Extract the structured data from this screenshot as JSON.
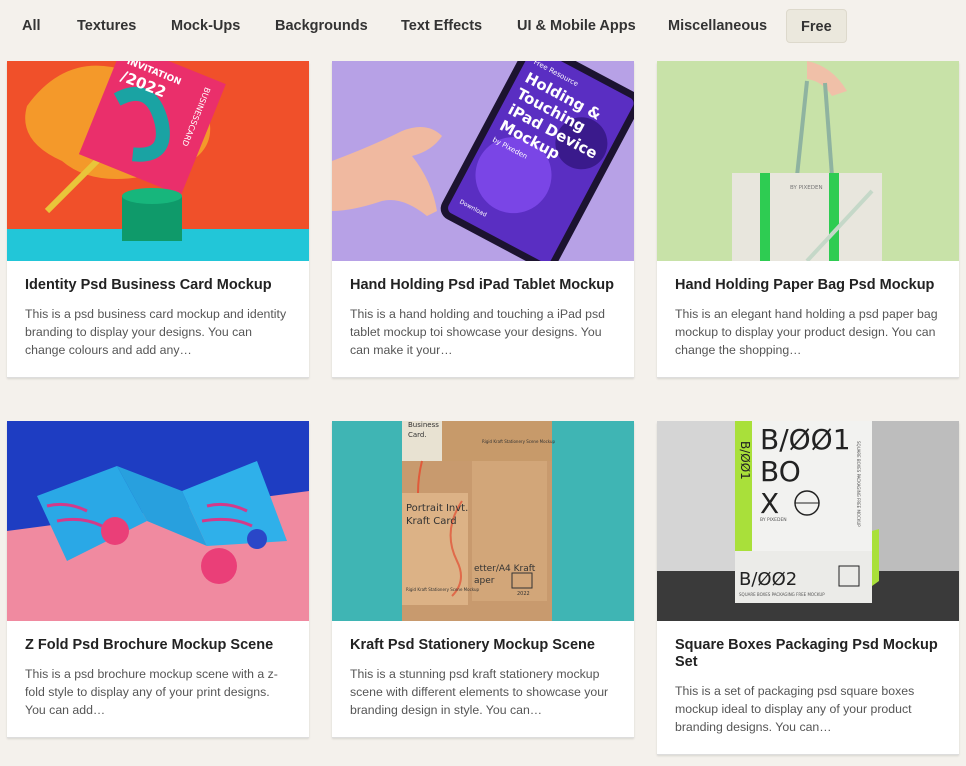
{
  "filters": [
    {
      "label": "All",
      "active": false
    },
    {
      "label": "Textures",
      "active": false
    },
    {
      "label": "Mock-Ups",
      "active": false
    },
    {
      "label": "Backgrounds",
      "active": false
    },
    {
      "label": "Text Effects",
      "active": false
    },
    {
      "label": "UI & Mobile Apps",
      "active": false
    },
    {
      "label": "Miscellaneous",
      "active": false
    },
    {
      "label": "Free",
      "active": true
    }
  ],
  "cards": [
    {
      "title": "Identity Psd Business Card Mockup",
      "description": "This is a psd business card mockup and identity branding to display your designs. You can change colours and add any…",
      "image_text": {
        "card_line1": "INVITATION",
        "card_line2": "/2022",
        "card_side": "BUSINESSCARD"
      }
    },
    {
      "title": "Hand Holding Psd iPad Tablet Mockup",
      "description": "This is a hand holding and touching a iPad psd tablet mockup toi showcase your designs. You can make it your…",
      "image_text": {
        "resource": "Free Resource",
        "l1": "Holding &",
        "l2": "Touching",
        "l3": "iPad Device",
        "l4": "Mockup",
        "l5": "by Pixeden",
        "download": "Download"
      }
    },
    {
      "title": "Hand Holding Paper Bag Psd Mockup",
      "description": "This is an elegant hand holding a psd paper bag mockup to display your product design. You can change the shopping…",
      "image_text": {
        "brand": "BY PIXEDEN"
      }
    },
    {
      "title": "Z Fold Psd Brochure Mockup Scene",
      "description": "This is a psd brochure mockup scene with a z-fold style to display any of your print designs. You can add…",
      "image_text": {}
    },
    {
      "title": "Kraft Psd Stationery Mockup Scene",
      "description": "This is a stunning psd kraft stationery mockup scene with different elements to showcase your branding design in style. You can…",
      "image_text": {
        "bc1": "Business",
        "bc2": "Card.",
        "top_caption": "Rigid Kraft Stationery Scene Mockup",
        "pt1": "Portrait Invt.",
        "pt2": "Kraft Card",
        "pt_caption": "Rigid Kraft Stationery Scene Mockup",
        "lt1": "etter/A4 Kraft",
        "lt2": "aper",
        "year": "2022"
      }
    },
    {
      "title": "Square Boxes Packaging Psd Mockup Set",
      "description": "This is a set of packaging psd square boxes mockup ideal to display any of your product branding designs. You can…",
      "image_text": {
        "big1": "B/ØØ1",
        "big2": "BO",
        "big3": "X",
        "side": "B/ØØ1",
        "brand": "BY PIXEDEN",
        "small": "B/ØØ2",
        "small_caption": "SQUARE BOXES PACKAGING FREE MOCKUP",
        "side_caption": "SQUARE BOXES PACKAGING FREE MOCKUP"
      }
    }
  ]
}
